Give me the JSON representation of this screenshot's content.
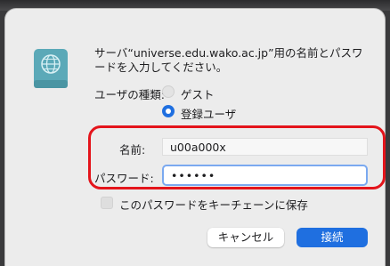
{
  "dialog": {
    "prompt": "サーバ“universe.edu.wako.ac.jp”用の名前とパスワードを入力してください。",
    "user_type_label": "ユーザの種類:",
    "options": {
      "guest": "ゲスト",
      "registered": "登録ユーザ",
      "selected": "登録ユーザ"
    },
    "name_label": "名前:",
    "name_value": "u00a000x",
    "password_label": "パスワード:",
    "password_value": "••••••",
    "keychain_label": "このパスワードをキーチェーンに保存",
    "keychain_checked": false,
    "cancel_button": "キャンセル",
    "connect_button": "接続"
  },
  "colors": {
    "accent": "#1f6fe0",
    "highlight": "#e4141b",
    "icon": "#5ba9b8"
  },
  "icons": {
    "server": "network-volume-icon"
  }
}
